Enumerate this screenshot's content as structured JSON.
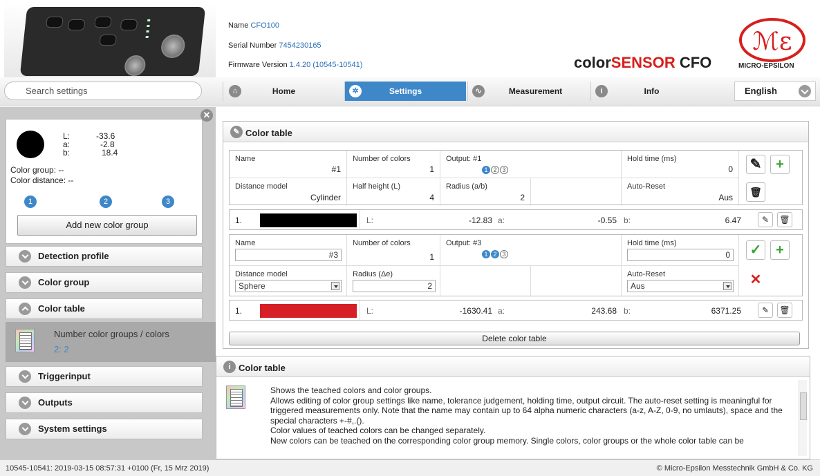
{
  "header": {
    "name_label": "Name",
    "name_value": "CFO100",
    "serial_label": "Serial Number",
    "serial_value": "7454230165",
    "firmware_label": "Firmware Version",
    "firmware_value": "1.4.20 (10545-10541)",
    "brand_prefix": "color",
    "brand_highlight": "SENSOR",
    "brand_suffix": " CFO",
    "logo_text": "MICRO-EPSILON",
    "logo_mark": "ℳε"
  },
  "nav": {
    "search_placeholder": "Search settings",
    "tabs": [
      {
        "label": "Home",
        "icon": "home-icon",
        "glyph": "⌂",
        "active": false
      },
      {
        "label": "Settings",
        "icon": "gear-icon",
        "glyph": "✲",
        "active": true
      },
      {
        "label": "Measurement",
        "icon": "wave-icon",
        "glyph": "∿",
        "active": false
      },
      {
        "label": "Info",
        "icon": "info-icon",
        "glyph": "i",
        "active": false
      }
    ],
    "language": "English"
  },
  "sidebar": {
    "L_label": "L:",
    "L_value": "-33.6",
    "a_label": "a:",
    "a_value": "-2.8",
    "b_label": "b:",
    "b_value": "18.4",
    "color_group": "Color group: --",
    "color_distance": "Color distance: --",
    "groups": [
      "1",
      "2",
      "3"
    ],
    "add_button": "Add new color group",
    "sections": [
      "Detection profile",
      "Color group",
      "Color table",
      "Triggerinput",
      "Outputs",
      "System settings"
    ],
    "sub_item_title": "Number color groups / colors",
    "sub_item_value": "2: 2"
  },
  "color_table": {
    "title": "Color table",
    "group1": {
      "name_label": "Name",
      "name_value": "#1",
      "num_label": "Number of colors",
      "num_value": "1",
      "output_label": "Output: #1",
      "output_dots": [
        "1",
        "2",
        "3"
      ],
      "hold_label": "Hold time (ms)",
      "hold_value": "0",
      "dist_label": "Distance model",
      "dist_value": "Cylinder",
      "half_label": "Half height (L)",
      "half_value": "4",
      "radius_label": "Radius (a/b)",
      "radius_value": "2",
      "auto_label": "Auto-Reset",
      "auto_value": "Aus",
      "color_row": {
        "index": "1.",
        "L": "L:",
        "L_value": "-12.83",
        "a": "a:",
        "a_value": "-0.55",
        "b": "b:",
        "b_value": "6.47",
        "swatch": "#000000"
      }
    },
    "group2": {
      "name_label": "Name",
      "name_value": "#3",
      "num_label": "Number of colors",
      "num_value": "1",
      "output_label": "Output: #3",
      "output_dots": [
        "1",
        "2",
        "3"
      ],
      "hold_label": "Hold time (ms)",
      "hold_value": "0",
      "dist_label": "Distance model",
      "dist_value": "Sphere",
      "radius_label": "Radius (Δe)",
      "radius_value": "2",
      "auto_label": "Auto-Reset",
      "auto_value": "Aus",
      "color_row": {
        "index": "1.",
        "L": "L:",
        "L_value": "-1630.41",
        "a": "a:",
        "a_value": "243.68",
        "b": "b:",
        "b_value": "6371.25",
        "swatch": "#d61f26"
      }
    },
    "delete_button": "Delete color table"
  },
  "info": {
    "title": "Color table",
    "lines": [
      "Shows the teached colors and color groups.",
      "Allows editing of color group settings like name, tolerance judgement, holding time, output circuit. The auto-reset setting is meaningful for triggered measurements only. Note that the name may contain up to 64 alpha numeric characters (a-z, A-Z, 0-9, no umlauts), space and the special characters +-#,.().",
      "Color values of teached colors can be changed separately.",
      "New colors can be teached on the corresponding color group memory. Single colors, color groups or the whole color table can be"
    ]
  },
  "footer": {
    "left": "10545-10541: 2019-03-15 08:57:31 +0100 (Fr, 15 Mrz 2019)",
    "right": "© Micro-Epsilon Messtechnik GmbH & Co. KG"
  }
}
